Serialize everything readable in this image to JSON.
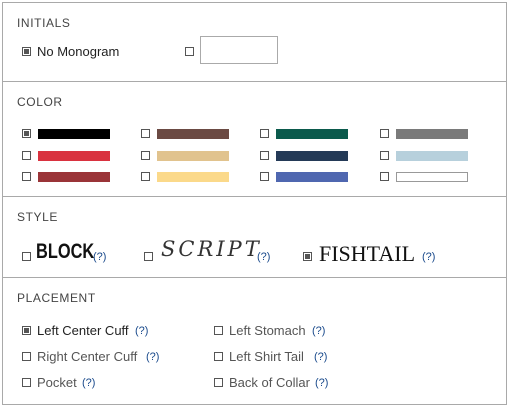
{
  "initials": {
    "title": "INITIALS",
    "no_monogram_label": "No Monogram",
    "no_monogram_checked": true,
    "custom_checked": false,
    "custom_value": ""
  },
  "color": {
    "title": "COLOR",
    "swatches": [
      {
        "name": "black",
        "hex": "#000000",
        "checked": true
      },
      {
        "name": "brown",
        "hex": "#6b4a43",
        "checked": false
      },
      {
        "name": "dark-teal",
        "hex": "#0b5a4c",
        "checked": false
      },
      {
        "name": "gray",
        "hex": "#7a7a7a",
        "checked": false
      },
      {
        "name": "red",
        "hex": "#d9323f",
        "checked": false
      },
      {
        "name": "tan",
        "hex": "#e1c38e",
        "checked": false
      },
      {
        "name": "navy",
        "hex": "#243a57",
        "checked": false
      },
      {
        "name": "light-blue",
        "hex": "#b7d0dc",
        "checked": false
      },
      {
        "name": "maroon",
        "hex": "#9a3438",
        "checked": false
      },
      {
        "name": "light-yellow",
        "hex": "#fbd98a",
        "checked": false
      },
      {
        "name": "blue",
        "hex": "#4f67b0",
        "checked": false
      },
      {
        "name": "white",
        "hex": "#ffffff",
        "checked": false
      }
    ]
  },
  "style": {
    "title": "STYLE",
    "options": [
      {
        "label": "BLOCK",
        "help": "(?)",
        "checked": false
      },
      {
        "label": "SCRIPT",
        "help": "(?)",
        "checked": false
      },
      {
        "label": "FISHTAIL",
        "help": "(?)",
        "checked": true
      }
    ]
  },
  "placement": {
    "title": "PLACEMENT",
    "options": [
      {
        "label": "Left Center Cuff",
        "help": "(?)",
        "checked": true
      },
      {
        "label": "Right Center Cuff",
        "help": "(?)",
        "checked": false
      },
      {
        "label": "Pocket",
        "help": "(?)",
        "checked": false
      },
      {
        "label": "Left Stomach",
        "help": "(?)",
        "checked": false
      },
      {
        "label": "Left Shirt Tail",
        "help": "(?)",
        "checked": false
      },
      {
        "label": "Back of Collar",
        "help": "(?)",
        "checked": false
      }
    ]
  }
}
